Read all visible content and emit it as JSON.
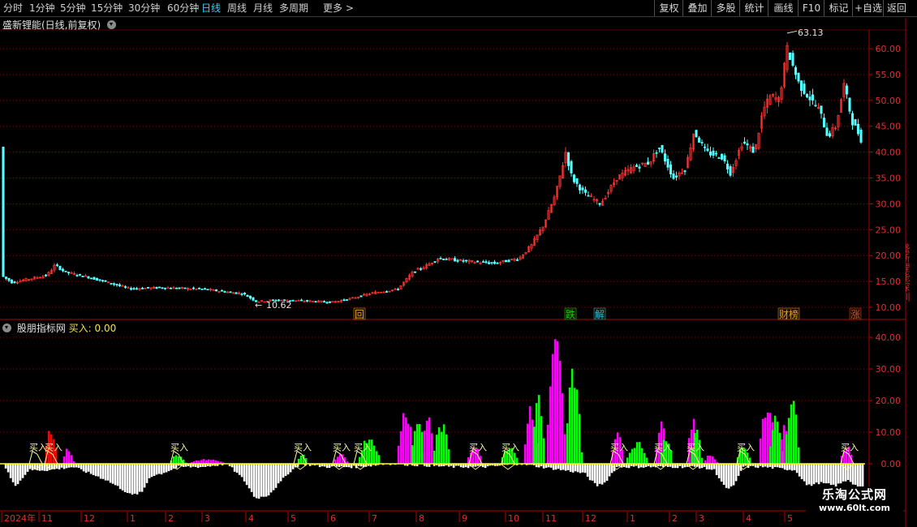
{
  "toolbar": {
    "periods": [
      "分时",
      "1分钟",
      "5分钟",
      "15分钟",
      "30分钟",
      "60分钟",
      "日线",
      "周线",
      "月线",
      "多周期",
      "更多 >"
    ],
    "active_period": "日线",
    "right_buttons": [
      "复权",
      "叠加",
      "多股",
      "统计",
      "画线",
      "F10",
      "标记",
      "+自选",
      "返回"
    ]
  },
  "stock_title": "盛新锂能(日线,前复权)",
  "indicator": {
    "name": "股朋指标网",
    "label": "买入: 0.00"
  },
  "price_axis": [
    "60.00",
    "55.00",
    "50.00",
    "45.00",
    "40.00",
    "35.00",
    "30.00",
    "25.00",
    "20.00",
    "15.00",
    "10.00"
  ],
  "ind_axis": [
    "40.00",
    "30.00",
    "20.00",
    "10.00",
    "0.00"
  ],
  "annotations": {
    "high": "63.13",
    "low": "10.62"
  },
  "event_tags": [
    "回",
    "跌",
    "解",
    "财榜",
    "涨"
  ],
  "buy_text": "买入",
  "date_axis": [
    "2024年",
    "11",
    "12",
    "1",
    "2",
    "3",
    "4",
    "5",
    "6",
    "7",
    "8",
    "9",
    "10",
    "11",
    "12",
    "1",
    "2",
    "3",
    "4",
    "5"
  ],
  "watermark": {
    "line1": "乐淘公式网",
    "line2": "www.60lt.com"
  },
  "right_strip": "盛新锂能深圳",
  "colors": {
    "up": "#ff3232",
    "down": "#54ffff",
    "magenta": "#ff00ff",
    "green": "#00ff00",
    "red_bar": "#ff0000",
    "yellow": "#ffff00",
    "white": "#ffffff",
    "grid": "#8b0000"
  },
  "chart_data": {
    "type": "candlestick+bar",
    "price_ylim": [
      8.5,
      65
    ],
    "indicator_ylim": [
      -12,
      42
    ],
    "high": 63.13,
    "low": 10.62
  }
}
